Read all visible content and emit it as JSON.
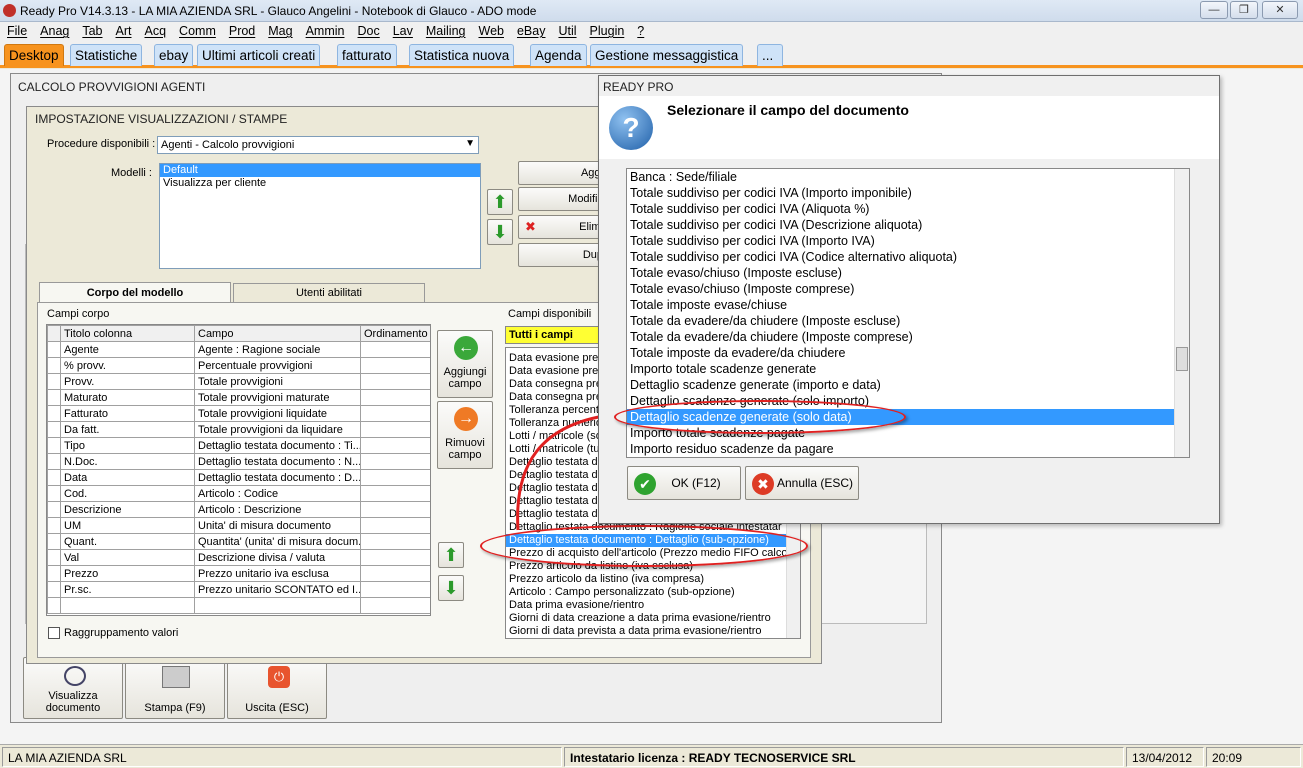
{
  "app": {
    "title": "Ready Pro V14.3.13 - LA MIA AZIENDA SRL - Glauco Angelini - Notebook di Glauco - ADO mode",
    "window_buttons": [
      "—",
      "❐",
      "✕"
    ]
  },
  "menu": [
    "File",
    "Anag",
    "Tab",
    "Art",
    "Acq",
    "Comm",
    "Prod",
    "Mag",
    "Ammin",
    "Doc",
    "Lav",
    "Mailing",
    "Web",
    "eBay",
    "Util",
    "Plugin",
    "?"
  ],
  "tabs": [
    "Desktop",
    "Statistiche",
    "ebay",
    "Ultimi articoli creati",
    "fatturato",
    "Statistica nuova",
    "Agenda",
    "Gestione messaggistica",
    "..."
  ],
  "calc_window": {
    "title": "CALCOLO PROVVIGIONI AGENTI",
    "buttons": {
      "view": "Visualizza documento",
      "print": "Stampa (F9)",
      "exit": "Uscita (ESC)"
    }
  },
  "settings_window": {
    "title": "IMPOSTAZIONE VISUALIZZAZIONI / STAMPE",
    "procedure_label": "Procedure disponibili :",
    "procedure_value": "Agenti - Calcolo provvigioni",
    "models_label": "Modelli :",
    "models": [
      "Default",
      "Visualizza per cliente"
    ],
    "side_buttons": [
      "Aggi",
      "Modific",
      "Elimi",
      "Dup"
    ],
    "subtabs": [
      "Corpo del modello",
      "Utenti abilitati"
    ],
    "campi_corpo_label": "Campi corpo",
    "columns": [
      "Titolo colonna",
      "Campo",
      "Ordinamento"
    ],
    "rows": [
      [
        "Agente",
        "Agente : Ragione sociale"
      ],
      [
        "% provv.",
        "Percentuale provvigioni"
      ],
      [
        "Provv.",
        "Totale provvigioni"
      ],
      [
        "Maturato",
        "Totale provvigioni maturate"
      ],
      [
        "Fatturato",
        "Totale provvigioni liquidate"
      ],
      [
        "Da fatt.",
        "Totale provvigioni da liquidare"
      ],
      [
        "Tipo",
        "Dettaglio testata documento : Ti..."
      ],
      [
        "N.Doc.",
        "Dettaglio testata documento : N..."
      ],
      [
        "Data",
        "Dettaglio testata documento : D..."
      ],
      [
        "Cod.",
        "Articolo : Codice"
      ],
      [
        "Descrizione",
        "Articolo : Descrizione"
      ],
      [
        "UM",
        "Unita' di misura documento"
      ],
      [
        "Quant.",
        "Quantita' (unita' di misura docum..."
      ],
      [
        "Val",
        "Descrizione divisa / valuta"
      ],
      [
        "Prezzo",
        "Prezzo unitario iva esclusa"
      ],
      [
        "Pr.sc.",
        "Prezzo unitario SCONTATO ed I..."
      ]
    ],
    "add_field": "Aggiungi campo",
    "remove_field": "Rimuovi campo",
    "group_values": "Raggruppamento valori",
    "campi_disponibili_label": "Campi disponibili",
    "filter": "Tutti i campi",
    "available_fields": [
      "Data evasione prev",
      "Data evasione prev",
      "Data consegna pre",
      "Data consegna pre",
      "Tolleranza percent",
      "Tolleranza numerio",
      "Lotti / matricole (so",
      "Lotti / matricole (tut",
      "Dettaglio testata do",
      "Dettaglio testata do",
      "Dettaglio testata do",
      "Dettaglio testata do",
      "Dettaglio testata do",
      "Dettaglio testata documento : Ragione sociale intestatar",
      "Dettaglio testata documento : Dettaglio (sub-opzione)",
      "Prezzo di acquisto dell'articolo (Prezzo medio FIFO calcola",
      "Prezzo articolo da listino (iva esclusa)",
      "Prezzo articolo da listino (iva compresa)",
      "Articolo : Campo personalizzato (sub-opzione)",
      "Data prima evasione/rientro",
      "Giorni di data creazione a data prima evasione/rientro",
      "Giorni di data prevista a data prima evasione/rientro"
    ],
    "available_selected_index": 14
  },
  "dialog": {
    "title": "READY PRO",
    "question": "Selezionare il campo del documento",
    "items": [
      "Banca : Sede/filiale",
      "Totale suddiviso per codici IVA (Importo imponibile)",
      "Totale suddiviso per codici IVA (Aliquota %)",
      "Totale suddiviso per codici IVA (Descrizione aliquota)",
      "Totale suddiviso per codici IVA (Importo IVA)",
      "Totale suddiviso per codici IVA (Codice alternativo aliquota)",
      "Totale evaso/chiuso (Imposte escluse)",
      "Totale evaso/chiuso (Imposte comprese)",
      "Totale imposte evase/chiuse",
      "Totale da evadere/da chiudere (Imposte escluse)",
      "Totale da evadere/da chiudere (Imposte comprese)",
      "Totale imposte da evadere/da chiudere",
      "Importo totale scadenze generate",
      "Dettaglio scadenze generate (importo e data)",
      "Dettaglio scadenze generate (solo importo)",
      "Dettaglio scadenze generate (solo data)",
      "Importo totale scadenze pagate",
      "Importo residuo scadenze da pagare"
    ],
    "selected_index": 15,
    "ok": "OK (F12)",
    "cancel": "Annulla (ESC)"
  },
  "status": {
    "company": "LA MIA AZIENDA SRL",
    "license": "Intestatario licenza : READY TECNOSERVICE SRL",
    "date": "13/04/2012",
    "time": "20:09"
  },
  "colors": {
    "accent_tab": "#f7931e",
    "selection": "#3399ff",
    "highlight_ring": "#e02020",
    "filter_bg": "#ffff33"
  }
}
